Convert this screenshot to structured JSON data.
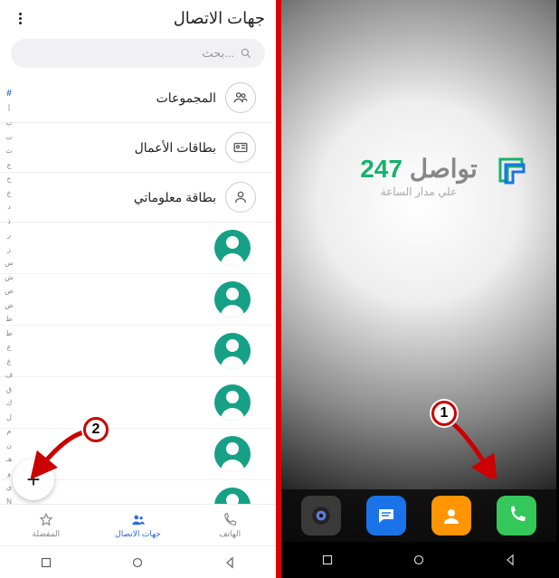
{
  "left": {
    "title": "جهات الاتصال",
    "search_placeholder": "بحث...",
    "rows": {
      "groups": "المجموعات",
      "business_cards": "بطاقات الأعمال",
      "my_info": "بطاقة معلوماتي"
    },
    "index": [
      "#",
      "أ",
      "ب",
      "ت",
      "ث",
      "ج",
      "ح",
      "خ",
      "د",
      "ذ",
      "ر",
      "ز",
      "س",
      "ش",
      "ص",
      "ض",
      "ط",
      "ظ",
      "ع",
      "غ",
      "ف",
      "ق",
      "ك",
      "ل",
      "م",
      "ن",
      "هـ",
      "و",
      "ي",
      "N"
    ],
    "fab": "+",
    "tabs": {
      "favorites": "المفضلة",
      "contacts": "جهات الاتصال",
      "phone": "الهاتف"
    }
  },
  "right": {
    "watermark_text": "تواصل",
    "watermark_num": "247",
    "watermark_sub": "علي مدار الساعة",
    "dock": {
      "camera": "camera",
      "messages": "messages",
      "contacts": "contacts",
      "phone": "phone"
    }
  },
  "callouts": {
    "one": "1",
    "two": "2"
  }
}
